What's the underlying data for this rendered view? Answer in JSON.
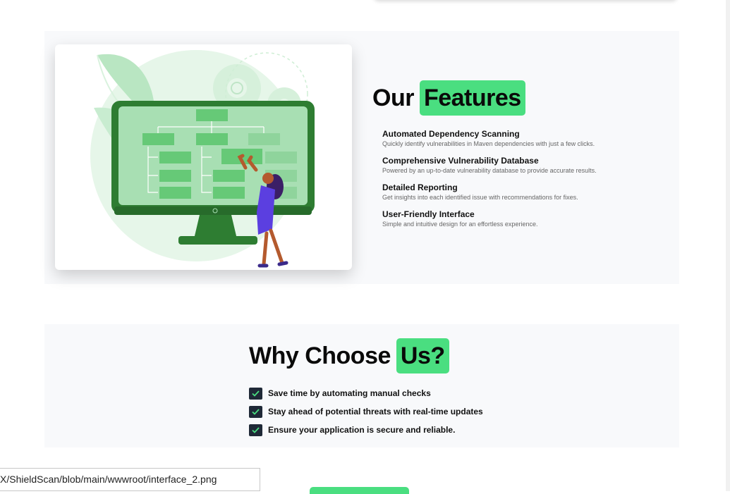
{
  "features": {
    "heading_plain": "Our",
    "heading_highlight": "Features",
    "items": [
      {
        "title": "Automated Dependency Scanning",
        "desc": "Quickly identify vulnerabilities in Maven dependencies with just a few clicks."
      },
      {
        "title": "Comprehensive Vulnerability Database",
        "desc": "Powered by an up-to-date vulnerability database to provide accurate results."
      },
      {
        "title": "Detailed Reporting",
        "desc": "Get insights into each identified issue with recommendations for fixes."
      },
      {
        "title": "User-Friendly Interface",
        "desc": "Simple and intuitive design for an effortless experience."
      }
    ]
  },
  "why": {
    "heading_plain": "Why Choose",
    "heading_highlight": "Us?",
    "items": [
      {
        "text": "Save time by automating manual checks"
      },
      {
        "text": "Stay ahead of potential threats with real-time updates"
      },
      {
        "text": "Ensure your application is secure and reliable."
      }
    ]
  },
  "status_url": "X/ShieldScan/blob/main/wwwroot/interface_2.png",
  "colors": {
    "accent": "#4ade80",
    "check": "#1f2937",
    "monitor": "#2e7d32"
  }
}
